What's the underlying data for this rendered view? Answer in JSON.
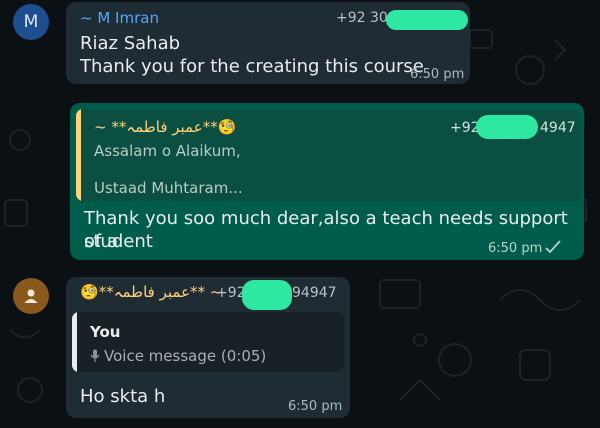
{
  "messages": [
    {
      "avatar_letter": "M",
      "sender": "~ M Imran",
      "phone": "+92 30",
      "text_line1": "Riaz Sahab",
      "text_line2": "Thank you for the creating this course",
      "time": "6:50 pm"
    },
    {
      "sender": "~ **عمبر فاطمہ**🧐",
      "phone": "+92 30",
      "phone_tail": "4947",
      "quote_line1": "Assalam o Alaikum,",
      "quote_line2": "Ustaad Muhtaram...",
      "text_line1": "Thank you soo much dear,also a teach needs support of a",
      "text_line2": "student",
      "time": "6:50 pm"
    },
    {
      "sender": "🧐**عمبر فاطمہ** ~",
      "phone": "+92",
      "phone_tail": "94947",
      "quote_author": "You",
      "quote_voice": "Voice message (0:05)",
      "text": "Ho skta h",
      "time": "6:50 pm"
    }
  ],
  "colors": {
    "background": "#0b1014",
    "incoming_bubble": "#1f2c33",
    "outgoing_bubble": "#005c4b",
    "redaction": "#2ee8a2",
    "sender_blue": "#53a6ff",
    "sender_gold": "#ffd279"
  },
  "icons": [
    "person-icon",
    "microphone-icon",
    "double-check-icon"
  ]
}
